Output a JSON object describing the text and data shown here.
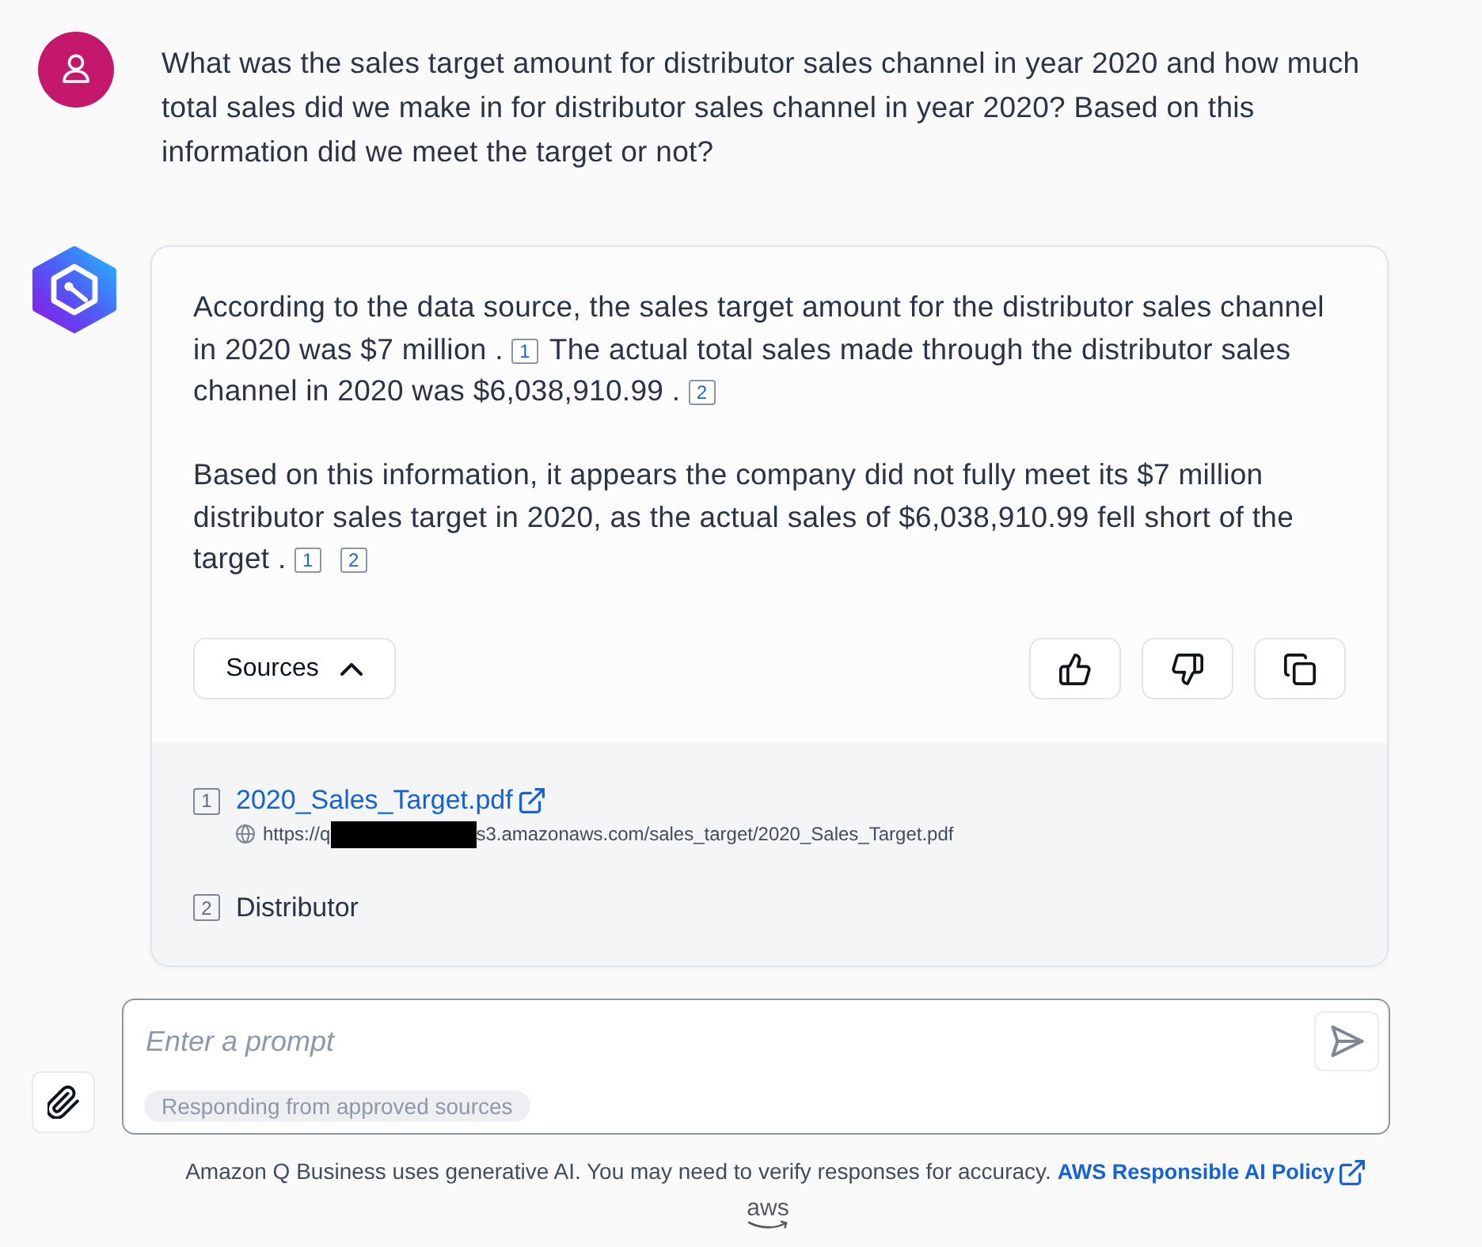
{
  "question": {
    "text": "What was the sales target amount for distributor sales channel in year 2020 and how much total sales did we make in for distributor sales channel in year 2020? Based on this information did we meet the target or not?"
  },
  "answer": {
    "paragraphs": [
      {
        "lines": [
          [
            {
              "kind": "text",
              "text": "According to the data source, the sales target amount for the distributor sales channel"
            }
          ],
          [
            {
              "kind": "text",
              "text": "in 2020 was $7 million ."
            },
            {
              "kind": "citation",
              "text": "1"
            },
            {
              "kind": "text",
              "text": "The actual total sales made through the distributor sales"
            }
          ],
          [
            {
              "kind": "text",
              "text": "channel in 2020 was $6,038,910.99 ."
            },
            {
              "kind": "citation",
              "text": "2"
            }
          ]
        ]
      },
      {
        "lines": [
          [
            {
              "kind": "text",
              "text": "Based on this information, it appears the company did not fully meet its $7 million"
            }
          ],
          [
            {
              "kind": "text",
              "text": "distributor sales target in 2020, as the actual sales of $6,038,910.99 fell short of the"
            }
          ],
          [
            {
              "kind": "text",
              "text": "target ."
            },
            {
              "kind": "citation",
              "text": "1"
            },
            {
              "kind": "citation",
              "text": "2"
            }
          ]
        ]
      }
    ]
  },
  "sources_toggle": {
    "label": "Sources",
    "expanded": true
  },
  "sources": [
    {
      "kind": "link",
      "number": "1",
      "title": "2020_Sales_Target.pdf",
      "url": {
        "start": "https://q",
        "redacted": true,
        "end": "s3.amazonaws.com/sales_target/2020_Sales_Target.pdf"
      }
    },
    {
      "kind": "text",
      "number": "2",
      "title": "Distributor"
    }
  ],
  "composer": {
    "placeholder": "Enter a prompt",
    "chip": "Responding from approved sources"
  },
  "footer": {
    "disclaimer": "Amazon Q Business uses generative AI. You may need to verify responses for accuracy.",
    "link": "AWS Responsible AI Policy",
    "logo": "aws"
  }
}
